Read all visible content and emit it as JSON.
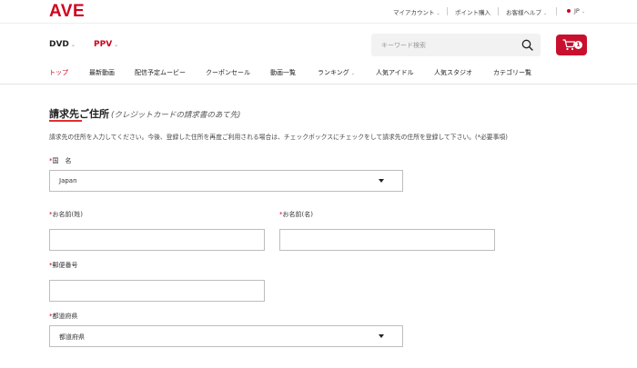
{
  "brand": {
    "logo": "AVE",
    "accent": "#d0021b"
  },
  "utility": {
    "my_account": "マイアカウント",
    "points": "ポイント購入",
    "help": "お客様ヘルプ",
    "lang": "JP"
  },
  "category_nav": {
    "dvd": "DVD",
    "ppv": "PPV"
  },
  "search": {
    "placeholder": "キーワード検索",
    "icon": "search-icon"
  },
  "cart": {
    "icon": "cart-icon",
    "count": "1"
  },
  "main_nav": {
    "items": [
      "トップ",
      "最新動画",
      "配信予定ムービー",
      "クーポンセール",
      "動画一覧",
      "ランキング",
      "人気アイドル",
      "人気スタジオ",
      "カテゴリー覧"
    ],
    "active": "トップ"
  },
  "form": {
    "title": "請求先ご住所",
    "subtitle": "(クレジットカードの請求書のあて先)",
    "intro": "請求先の住所を入力してください。今後、登録した住所を再度ご利用される場合は、チェックボックスにチェックをして請求先の住所を登録して下さい。(*必要事項)",
    "required_mark": "*",
    "country_label": "国　名",
    "country_value": "Japan",
    "last_name_label": "お名前(姓)",
    "last_name_value": "",
    "first_name_label": "お名前(名)",
    "first_name_value": "",
    "postal_label": "郵便番号",
    "postal_value": "",
    "prefecture_label": "都道府県",
    "prefecture_value": "都道府県"
  }
}
